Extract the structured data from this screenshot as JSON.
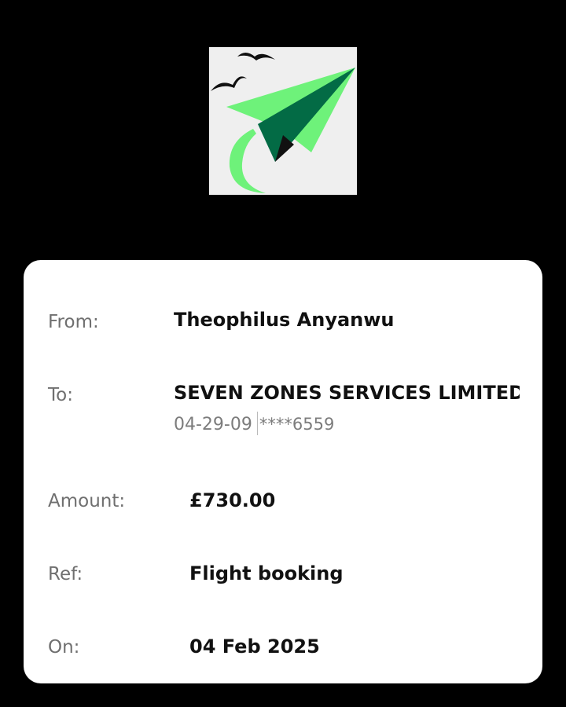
{
  "transfer": {
    "from_label": "From:",
    "from_value": "Theophilus Anyanwu",
    "to_label": "To:",
    "to_value": "SEVEN ZONES SERVICES LIMITED",
    "sort_code": "04-29-09",
    "account_masked": "****6559",
    "amount_label": "Amount:",
    "amount_value": "£730.00",
    "ref_label": "Ref:",
    "ref_value": "Flight booking",
    "on_label": "On:",
    "on_value": "04 Feb 2025"
  },
  "logo": {
    "icon": "paper-plane-with-birds-icon",
    "colors": {
      "background": "#efefef",
      "plane_light": "#6ef27a",
      "plane_dark": "#036b45",
      "birds": "#111111"
    }
  },
  "colors": {
    "page_background": "#000000",
    "card_background": "#ffffff",
    "label_text": "#6f6f6f",
    "value_text": "#111111"
  }
}
